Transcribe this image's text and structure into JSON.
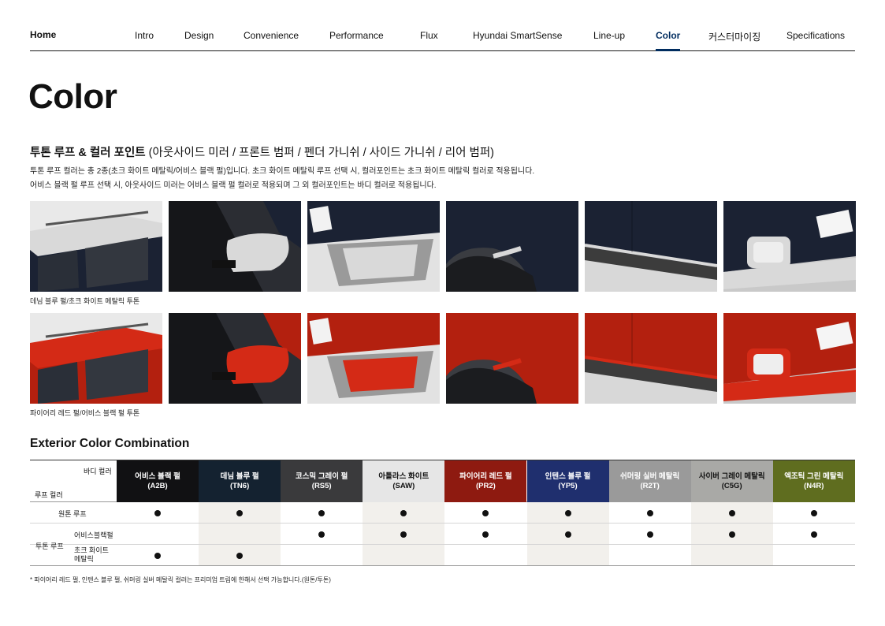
{
  "nav": {
    "home": "Home",
    "items": [
      "Intro",
      "Design",
      "Convenience",
      "Performance",
      "Flux",
      "Hyundai SmartSense",
      "Line-up",
      "Color",
      "커스터마이징",
      "Specifications"
    ],
    "active": "Color"
  },
  "page_title": "Color",
  "section": {
    "heading_bold": "투톤 루프 & 컬러 포인트",
    "heading_rest": " (아웃사이드 미러 / 프론트 범퍼 / 펜더 가니쉬 / 사이드 가니쉬 / 리어 범퍼)",
    "desc_line1": "투톤 루프 컬러는 총 2종(초크 화이트 메탈릭/어비스 블랙 펄)입니다. 초크 화이트 메탈릭 루프 선택 시, 컬러포인트는 초크 화이트 메탈릭 컬러로 적용됩니다.",
    "desc_line2": "어비스 블랙 펄 루프 선택 시, 아웃사이드 미러는 어비스 블랙 펄 컬러로 적용되며 그 외 컬러포인트는 바디 컬러로 적용됩니다."
  },
  "photo_rows": [
    {
      "caption": "데님 블루 펄/초크 화이트 메탈릭 투톤",
      "body_color": "#1b2233",
      "accent_color": "#d9d9d9",
      "photos": [
        "roof",
        "mirror",
        "front-bumper",
        "fender-garnish",
        "side-garnish",
        "rear-bumper"
      ]
    },
    {
      "caption": "파이어리 레드 펄/어비스 블랙 펄 투톤",
      "body_color": "#b3200f",
      "accent_color": "#d42a16",
      "photos": [
        "roof",
        "mirror",
        "front-bumper",
        "fender-garnish",
        "side-garnish",
        "rear-bumper"
      ]
    }
  ],
  "combination": {
    "title": "Exterior Color Combination",
    "corner_top": "바디 컬러",
    "corner_bottom": "루프 컬러",
    "colors": [
      {
        "name": "어비스 블랙 펄",
        "code": "(A2B)",
        "hex": "#111113",
        "text": "dark"
      },
      {
        "name": "데님 블루 펄",
        "code": "(TN6)",
        "hex": "#142230",
        "text": "dark"
      },
      {
        "name": "코스믹 그레이 펄",
        "code": "(RS5)",
        "hex": "#3a3a3c",
        "text": "dark"
      },
      {
        "name": "아틀라스 화이트",
        "code": "(SAW)",
        "hex": "#e6e6e6",
        "text": "light"
      },
      {
        "name": "파이어리 레드 펄",
        "code": "(PR2)",
        "hex": "#8e1a10",
        "text": "dark"
      },
      {
        "name": "인텐스 블루 펄",
        "code": "(YP5)",
        "hex": "#1f2f6e",
        "text": "dark"
      },
      {
        "name": "쉬머링 실버 메탈릭",
        "code": "(R2T)",
        "hex": "#9a9a9a",
        "text": "dark"
      },
      {
        "name": "사이버 그레이 메탈릭",
        "code": "(C5G)",
        "hex": "#a9a9a6",
        "text": "light"
      },
      {
        "name": "엑조틱 그린 메탈릭",
        "code": "(N4R)",
        "hex": "#5f6d1f",
        "text": "dark"
      }
    ],
    "rows": [
      {
        "group": "",
        "label": "원톤 루프",
        "marks": [
          true,
          true,
          true,
          true,
          true,
          true,
          true,
          true,
          true
        ]
      },
      {
        "group": "투톤 루프",
        "label": "어비스블랙펄",
        "marks": [
          false,
          false,
          true,
          true,
          true,
          true,
          true,
          true,
          true
        ]
      },
      {
        "group": "",
        "label": "초크 화이트\n메탈릭",
        "marks": [
          true,
          true,
          false,
          false,
          false,
          false,
          false,
          false,
          false
        ]
      }
    ],
    "footnote": "* 파이어리 레드 펄, 인텐스 블루 펄, 쉬머링 실버 메탈릭 컬러는 프리미엄 트림에 한해서 선택 가능합니다.(원톤/투톤)"
  }
}
